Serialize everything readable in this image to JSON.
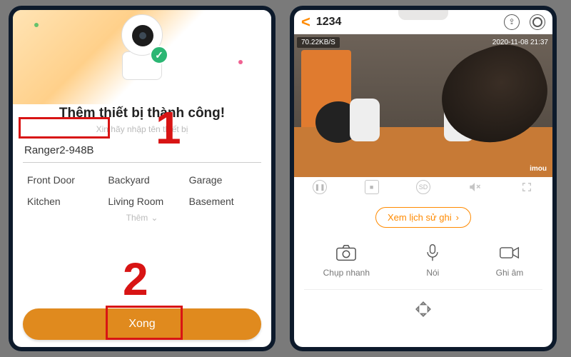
{
  "left": {
    "title": "Thêm thiết bị thành công!",
    "subtitle": "Xin hãy nhập tên     thiết bị",
    "device_name": "Ranger2-948B",
    "chips": [
      "Front Door",
      "Backyard",
      "Garage",
      "Kitchen",
      "Living Room",
      "Basement"
    ],
    "more": "Thêm",
    "done": "Xong",
    "annotations": {
      "step1": "1",
      "step2": "2"
    }
  },
  "right": {
    "back": "<",
    "title": "1234",
    "bitrate": "70.22KB/S",
    "timestamp": "2020-11-08 21:37",
    "watermark": "imou",
    "history_btn": "Xem lịch sử ghi",
    "actions": [
      {
        "label": "Chụp nhanh",
        "icon": "camera"
      },
      {
        "label": "Nói",
        "icon": "mic"
      },
      {
        "label": "Ghi âm",
        "icon": "record"
      }
    ]
  },
  "colors": {
    "accent": "#ff8a00",
    "danger": "#d81414",
    "done": "#e08a1e"
  }
}
